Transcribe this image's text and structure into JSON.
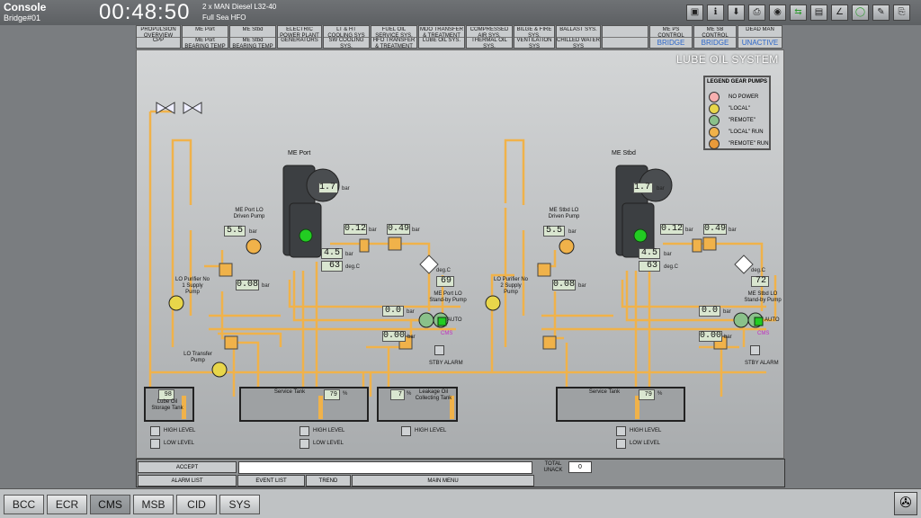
{
  "window": {
    "title": "Console",
    "subtitle": "Bridge#01",
    "clock": "00:48:50",
    "engine_line1": "2 x MAN Diesel L32-40",
    "engine_line2": "Full Sea HFO"
  },
  "nav": [
    {
      "l1": "PROPULSION OVERVIEW",
      "l2": "CPP"
    },
    {
      "l1": "ME Port",
      "l2": "ME Port BEARING TEMP"
    },
    {
      "l1": "ME Stbd",
      "l2": "ME Stbd BEARING TEMP"
    },
    {
      "l1": "ELECTRIC POWER PLANT",
      "l2": "GENERATORS"
    },
    {
      "l1": "LT & HT COOLING SYS",
      "l2": "SW COOLING SYS."
    },
    {
      "l1": "FUEL OIL SERVICE SYS.",
      "l2": "HFO TRANSFER & TREATMENT"
    },
    {
      "l1": "MDO TRANSFER & TREATMENT",
      "l2": "LUBE OIL SYS."
    },
    {
      "l1": "COMPRESSED AIR SYS.",
      "l2": "THERMAL OIL SYS."
    },
    {
      "l1": "BILGE & FIRE SYS.",
      "l2": "VENTILATION SYS"
    },
    {
      "l1": "BALLAST SYS.",
      "l2": "CHILLED WATER SYS"
    },
    {
      "l1": "",
      "l2": ""
    },
    {
      "l1": "ME PS CONTROL",
      "l2": "BRIDGE"
    },
    {
      "l1": "ME SB CONTROL",
      "l2": "BRIDGE"
    },
    {
      "l1": "DEAD MAN",
      "l2": "UNACTIVE"
    }
  ],
  "system_title": "LUBE OIL SYSTEM",
  "legend": {
    "title": "LEGEND GEAR PUMPS",
    "items": [
      "NO POWER",
      "\"LOCAL\"",
      "\"REMOTE\"",
      "\"LOCAL\" RUN",
      "\"REMOTE\" RUN"
    ]
  },
  "port": {
    "engine": "ME Port",
    "pressure": "1.7",
    "p1": "0.12",
    "p2": "0.49",
    "p3": "4.5",
    "temp": "63",
    "driven_pump": "ME Port  LO Driven Pump",
    "driven_val": "5.5",
    "filter_dp": "0.08",
    "purifier": "LO Purifier No 1 Supply Pump",
    "temp2": "69",
    "standby": "ME Port LO Stand-by Pump",
    "standby_val": "0.0",
    "auto": "AUTO",
    "cms": "CMS",
    "standby_dp": "0.00",
    "stby_alarm": "STBY ALARM"
  },
  "stbd": {
    "engine": "ME Stbd",
    "pressure": "1.7",
    "p1": "0.12",
    "p2": "0.49",
    "p3": "4.5",
    "temp": "63",
    "driven_pump": "ME Stbd  LO Driven Pump",
    "driven_val": "5.5",
    "filter_dp": "0.08",
    "purifier": "LO Purifier No 2 Supply Pump",
    "temp2": "72",
    "standby": "ME Stbd LO Stand-by Pump",
    "standby_val": "0.0",
    "auto": "AUTO",
    "cms": "CMS",
    "standby_dp": "0.00",
    "stby_alarm": "STBY ALARM"
  },
  "units": {
    "bar": "bar",
    "degc": "deg.C",
    "pct": "%"
  },
  "transfer_pump": "LO Transfer Pump",
  "tanks": {
    "storage": {
      "label": "Lube Oil Storage Tank",
      "level": "98"
    },
    "service_port": {
      "label": "Service Tank",
      "level": "79"
    },
    "leakage": {
      "label": "Leakage Oil Collecting Tank",
      "level": "7"
    },
    "service_stbd": {
      "label": "Service Tank",
      "level": "79"
    }
  },
  "levels": {
    "high": "HIGH LEVEL",
    "low": "LOW LEVEL"
  },
  "alarm": {
    "accept": "ACCEPT",
    "alarm_list": "ALARM LIST",
    "event_list": "EVENT LIST",
    "trend": "TREND",
    "main_menu": "MAIN MENU",
    "total": "TOTAL",
    "unack": "UNACK",
    "count": "0"
  },
  "tabs": [
    "BCC",
    "ECR",
    "CMS",
    "MSB",
    "CID",
    "SYS"
  ],
  "colors": {
    "pipe": "#f0b24a",
    "value_bg": "#d9e6d0",
    "green": "#22cc22"
  }
}
